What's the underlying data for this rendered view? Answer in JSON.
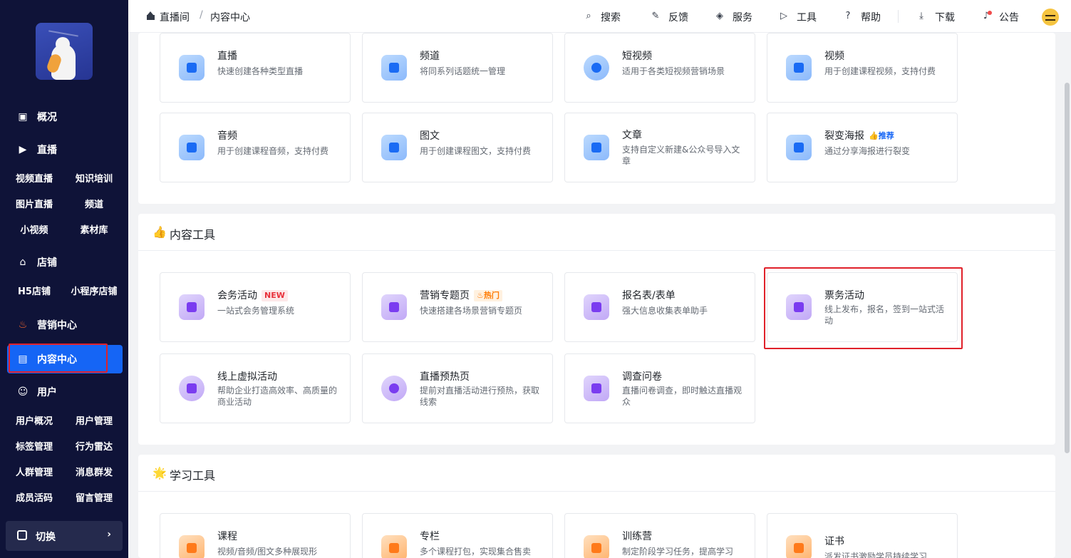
{
  "sidebar": {
    "sections": [
      {
        "icon": "dashboard-icon",
        "label": "概况"
      },
      {
        "icon": "live-icon",
        "label": "直播"
      },
      {
        "icon": "store-icon",
        "label": "店铺"
      },
      {
        "icon": "fire-icon",
        "label": "营销中心"
      },
      {
        "icon": "document-icon",
        "label": "内容中心"
      },
      {
        "icon": "users-icon",
        "label": "用户"
      }
    ],
    "live_items": [
      "视频直播",
      "知识培训",
      "图片直播",
      "频道",
      "小视频",
      "素材库"
    ],
    "store_items": [
      "H5店铺",
      "小程序店铺"
    ],
    "user_items": [
      "用户概况",
      "用户管理",
      "标签管理",
      "行为雷达",
      "人群管理",
      "消息群发",
      "成员活码",
      "留言管理"
    ],
    "switch_label": "切换",
    "switch_chevron": "›"
  },
  "topbar": {
    "breadcrumb": [
      "直播间",
      "内容中心"
    ],
    "separator": "/",
    "tools": [
      {
        "icon": "search-icon",
        "label": "搜索"
      },
      {
        "icon": "feedback-icon",
        "label": "反馈"
      },
      {
        "icon": "service-icon",
        "label": "服务"
      },
      {
        "icon": "tools-icon",
        "label": "工具"
      },
      {
        "icon": "help-icon",
        "label": "帮助"
      },
      {
        "icon": "download-icon",
        "label": "下载"
      },
      {
        "icon": "bell-icon",
        "label": "公告"
      }
    ]
  },
  "content_types": [
    {
      "title": "直播",
      "desc": "快速创建各种类型直播",
      "icon": "live-icon"
    },
    {
      "title": "频道",
      "desc": "将同系列话题统一管理",
      "icon": "channel-icon"
    },
    {
      "title": "短视频",
      "desc": "适用于各类短视频营销场景",
      "icon": "short-video-icon"
    },
    {
      "title": "视频",
      "desc": "用于创建课程视频，支持付费",
      "icon": "video-icon"
    },
    {
      "title": "音频",
      "desc": "用于创建课程音频，支持付费",
      "icon": "audio-icon"
    },
    {
      "title": "图文",
      "desc": "用于创建课程图文，支持付费",
      "icon": "image-text-icon"
    },
    {
      "title": "文章",
      "desc": "支持自定义新建&公众号导入文章",
      "icon": "article-icon"
    },
    {
      "title": "裂变海报",
      "desc": "通过分享海报进行裂变",
      "badge": "推荐",
      "icon": "poster-icon"
    }
  ],
  "content_tools": {
    "title": "内容工具",
    "emoji": "👍",
    "items": [
      {
        "title": "会务活动",
        "desc": "一站式会务管理系统",
        "badge": "NEW",
        "icon": "conference-icon"
      },
      {
        "title": "营销专题页",
        "desc": "快速搭建各场景营销专题页",
        "badge": "热门",
        "icon": "topic-page-icon"
      },
      {
        "title": "报名表/表单",
        "desc": "强大信息收集表单助手",
        "icon": "form-icon"
      },
      {
        "title": "票务活动",
        "desc": "线上发布，报名，签到一站式活动",
        "icon": "ticket-icon"
      },
      {
        "title": "线上虚拟活动",
        "desc": "帮助企业打造高效率、高质量的商业活动",
        "icon": "virtual-event-icon"
      },
      {
        "title": "直播预热页",
        "desc": "提前对直播活动进行预热，获取线索",
        "icon": "preheat-icon"
      },
      {
        "title": "调查问卷",
        "desc": "直播问卷调查，即时触达直播观众",
        "icon": "survey-icon"
      }
    ]
  },
  "learning_tools": {
    "title": "学习工具",
    "emoji": "🌟",
    "items": [
      {
        "title": "课程",
        "desc": "视频/音频/图文多种展现形",
        "icon": "course-icon"
      },
      {
        "title": "专栏",
        "desc": "多个课程打包，实现集合售卖",
        "icon": "column-icon"
      },
      {
        "title": "训练营",
        "desc": "制定阶段学习任务，提高学习",
        "icon": "camp-icon"
      },
      {
        "title": "证书",
        "desc": "派发证书激励学员持续学习",
        "icon": "certificate-icon"
      }
    ]
  }
}
